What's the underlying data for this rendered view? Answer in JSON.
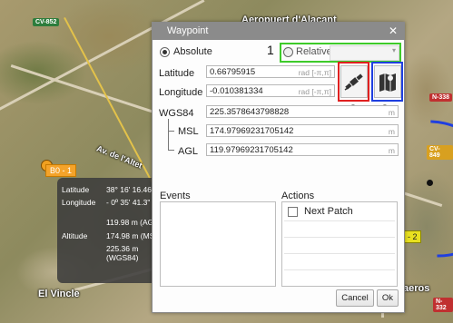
{
  "map": {
    "airport_label": "Aeropuert d'Alacant",
    "street_label": "Av. de l'Altet",
    "town_label": "El Vincle",
    "partial_label": "aeros",
    "road_badges": [
      "CV-852",
      "N-338",
      "CV-849",
      "N-332"
    ],
    "waypoint_1_label": "B0 - 1",
    "waypoint_2_label": "- 2",
    "route_color": "#1f3fe0"
  },
  "info_box": {
    "latitude_label": "Latitude",
    "latitude_value": "38° 16' 16.46\"",
    "longitude_label": "Longitude",
    "longitude_value": "- 0º 35' 41.3\"",
    "altitude_label": "Altitude",
    "agl": "119.98 m  (AGL)",
    "msl": "174.98 m  (MSL)",
    "wgs": "225.36 m  (WGS84)"
  },
  "dialog": {
    "title": "Waypoint",
    "absolute_label": "Absolute",
    "relative_label": "Relative",
    "latitude_label": "Latitude",
    "latitude_value": "0.66795915",
    "latitude_unit": "rad [-π,π]",
    "longitude_label": "Longitude",
    "longitude_value": "-0.010381334",
    "longitude_unit": "rad [-π,π]",
    "wgs84_label": "WGS84",
    "wgs84_value": "225.3578643798828",
    "wgs84_unit": "m",
    "msl_label": "MSL",
    "msl_value": "174.97969231705142",
    "msl_unit": "m",
    "agl_label": "AGL",
    "agl_value": "119.97969231705142",
    "agl_unit": "m",
    "events_label": "Events",
    "actions_label": "Actions",
    "next_patch_label": "Next Patch",
    "cancel_label": "Cancel",
    "ok_label": "Ok"
  },
  "callouts": {
    "one": "1",
    "two": "2",
    "three": "3",
    "color_green": "#3ecb2a",
    "color_red": "#e02020",
    "color_blue": "#1f3fe0"
  }
}
